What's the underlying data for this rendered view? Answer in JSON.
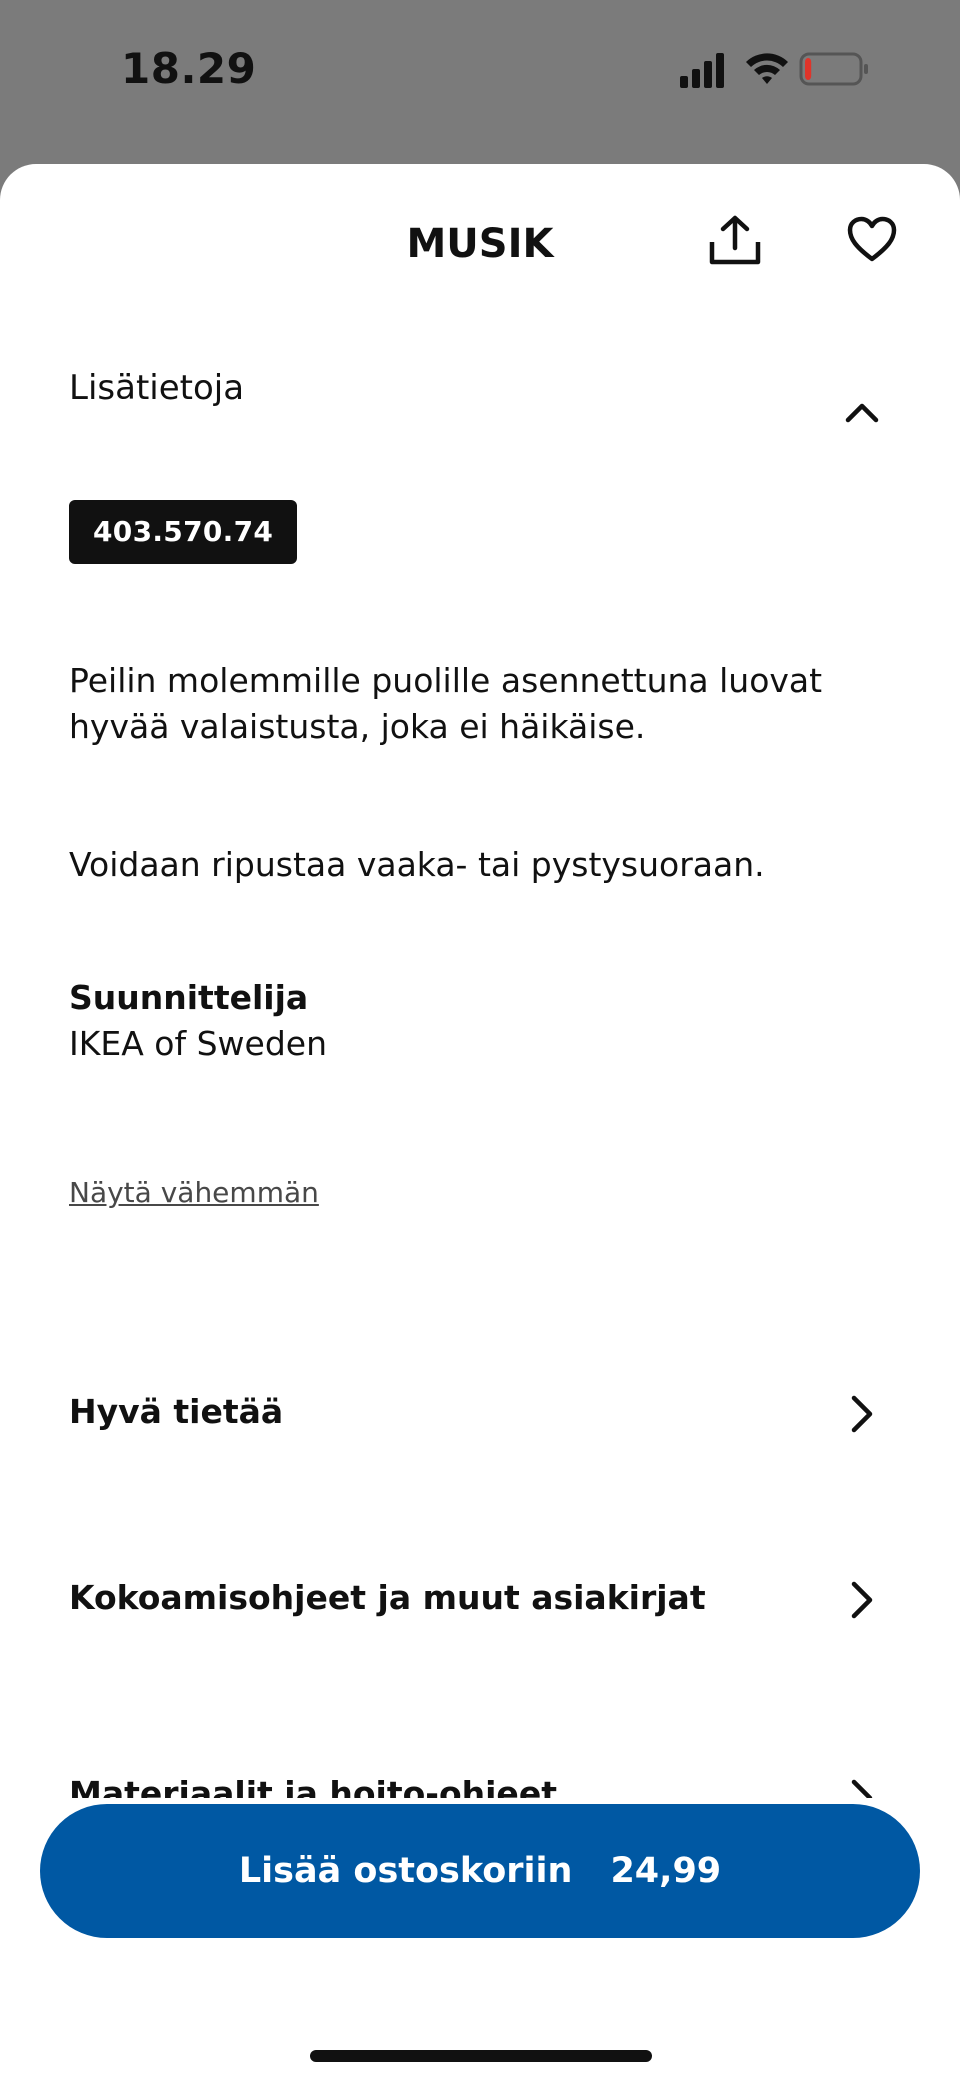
{
  "status_bar": {
    "time": "18.29",
    "battery_level": 0.12,
    "battery_color": "#e0342a"
  },
  "header": {
    "title": "MUSIK",
    "share_icon": "share-icon",
    "favorite_icon": "heart-icon"
  },
  "details": {
    "section_title": "Lisätietoja",
    "article_number": "403.570.74",
    "paragraphs": [
      "Peilin molemmille puolille asennettuna luovat hyvää valaistusta, joka ei häikäise.",
      "Voidaan ripustaa vaaka- tai pystysuoraan."
    ],
    "designer_label": "Suunnittelija",
    "designer_name": "IKEA of Sweden",
    "show_less": "Näytä vähemmän"
  },
  "sections": [
    {
      "label": "Hyvä tietää"
    },
    {
      "label": "Kokoamisohjeet ja muut asiakirjat"
    },
    {
      "label": "Materiaalit ja hoito-ohjeet"
    }
  ],
  "cta": {
    "label": "Lisää ostoskoriin",
    "price": "24,99",
    "color": "#0058a3"
  }
}
